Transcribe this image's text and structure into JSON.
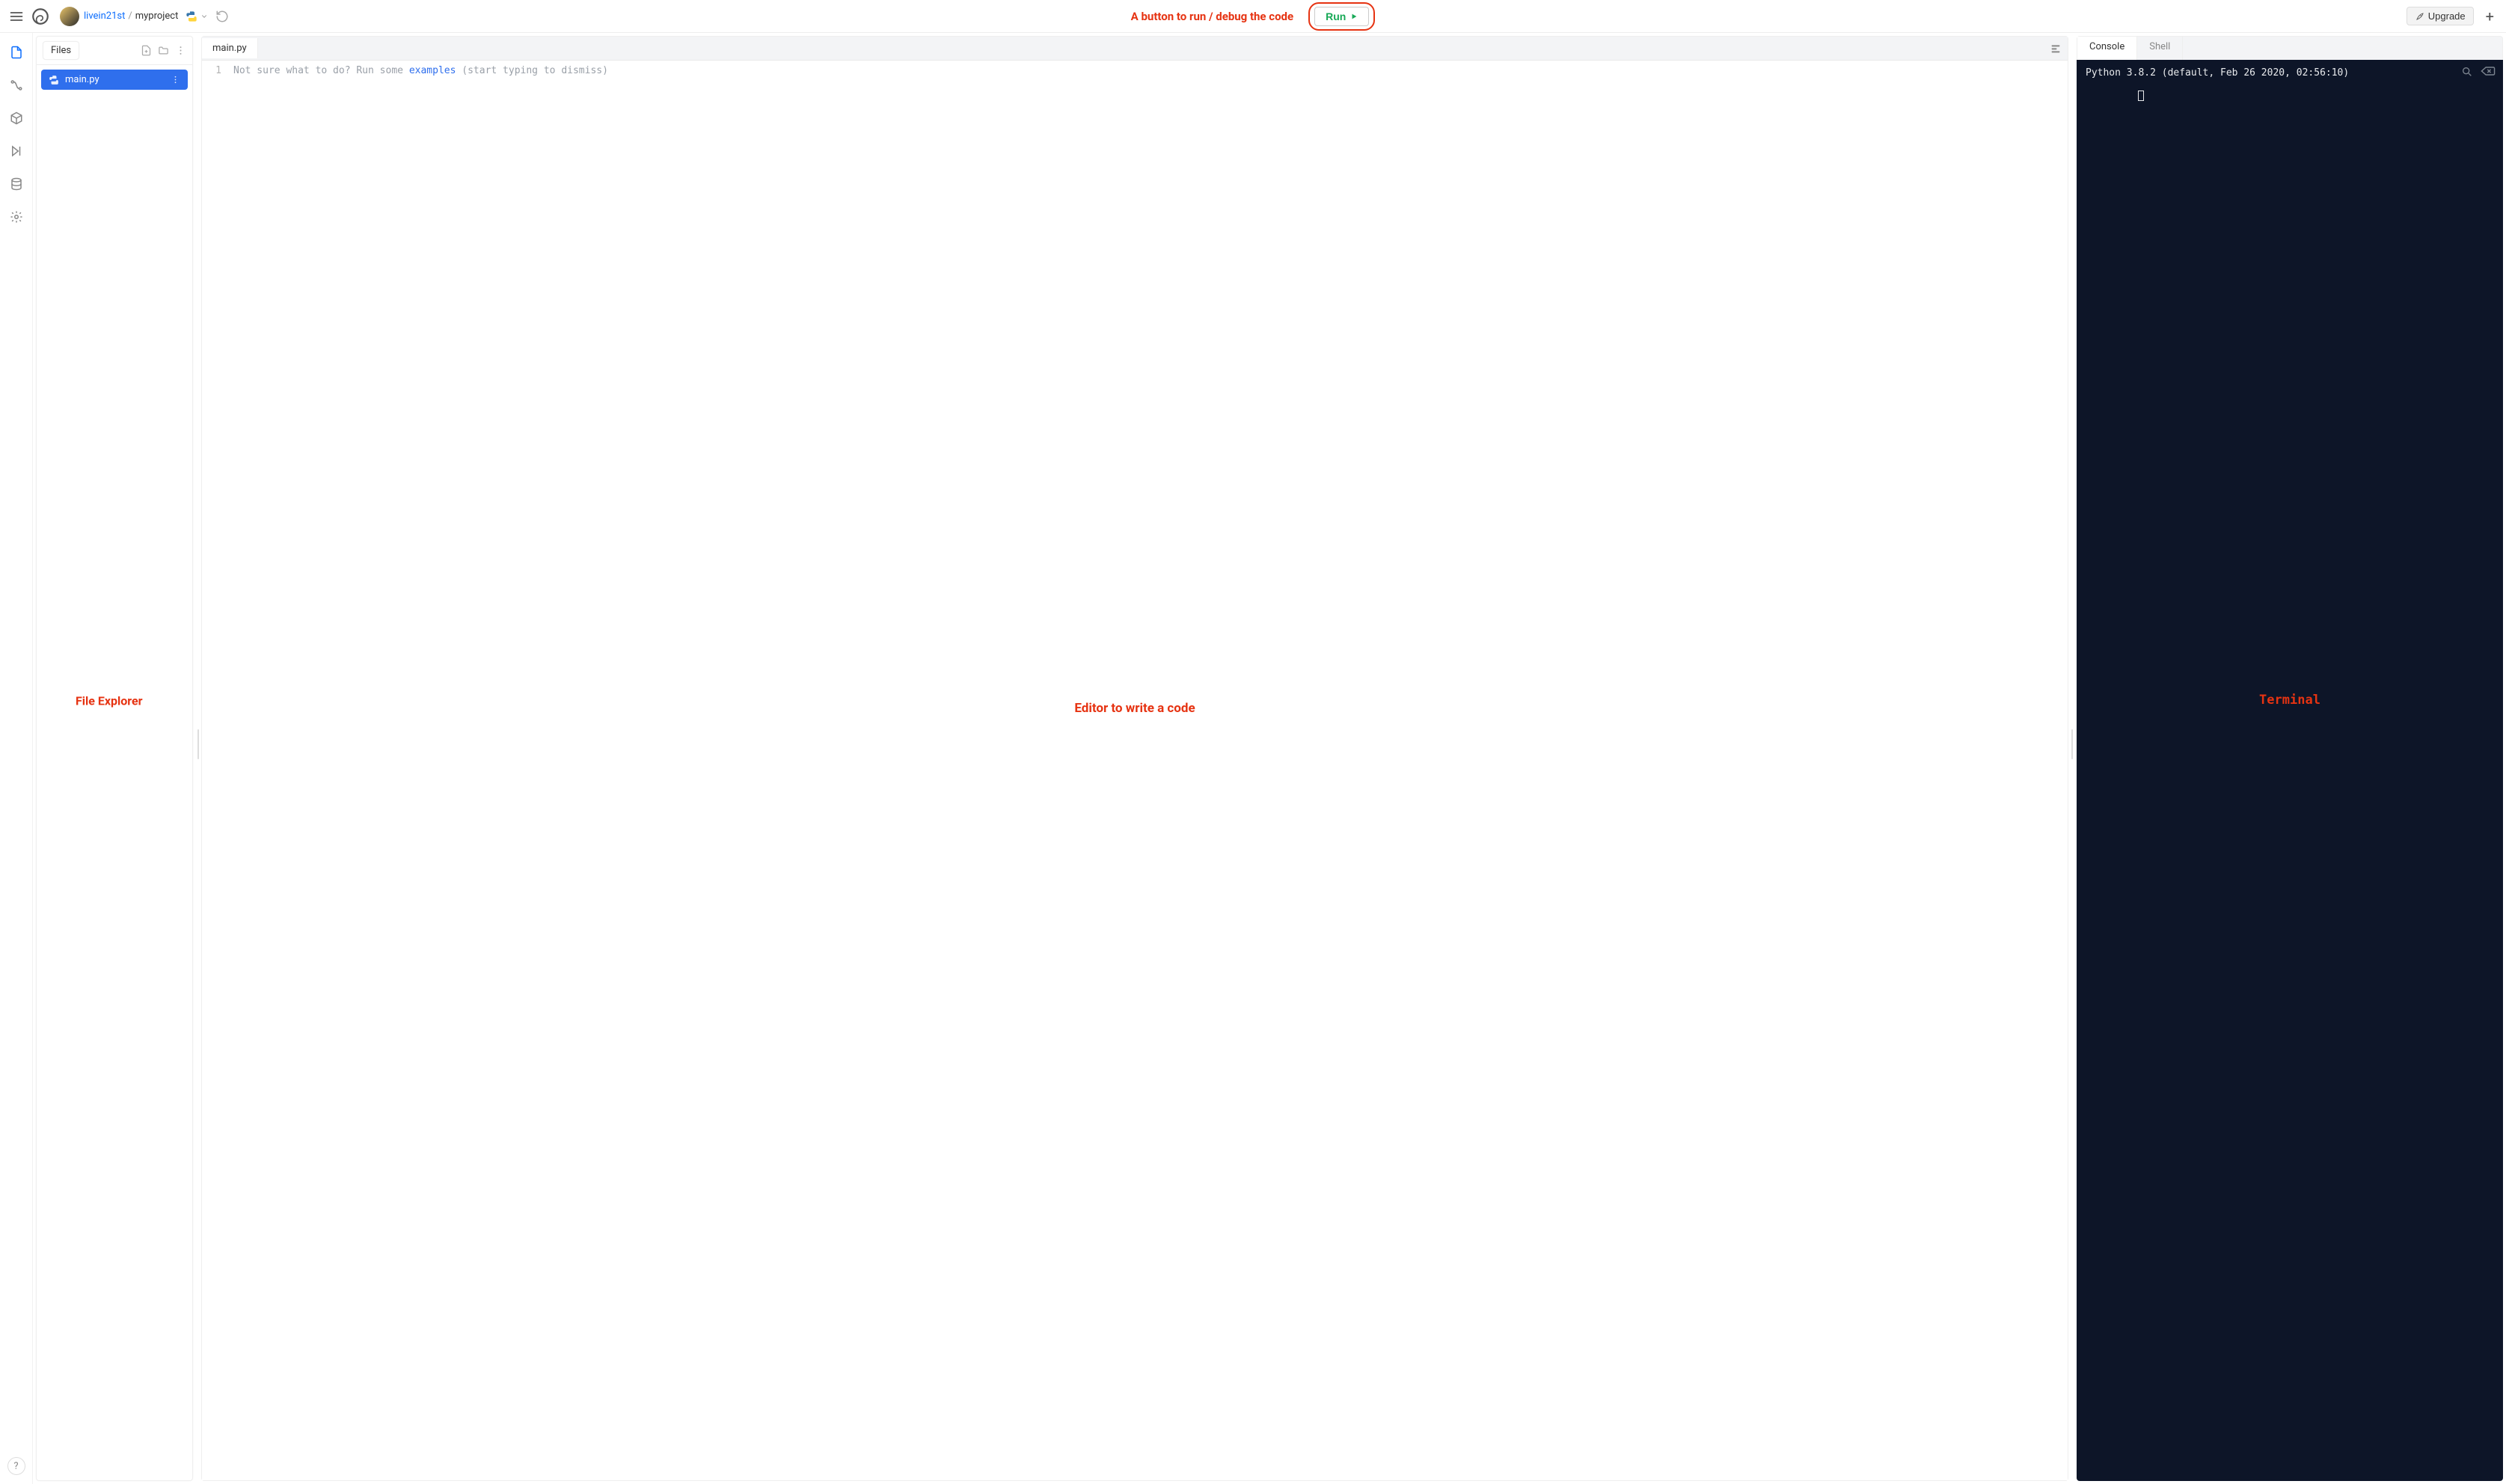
{
  "header": {
    "username": "livein21st",
    "project": "myproject",
    "run_label": "Run",
    "upgrade_label": "Upgrade"
  },
  "annotations": {
    "run_button": "A button to run / debug the code",
    "file_explorer": "File Explorer",
    "editor": "Editor to write a code",
    "terminal": "Terminal"
  },
  "filepanel": {
    "tab_label": "Files",
    "files": [
      {
        "name": "main.py"
      }
    ]
  },
  "editor": {
    "tab": "main.py",
    "line_number": "1",
    "placeholder_pre": "Not sure what to do? Run some ",
    "placeholder_link": "examples",
    "placeholder_post": " (start typing to dismiss)"
  },
  "console": {
    "tabs": {
      "console": "Console",
      "shell": "Shell"
    },
    "line1": "Python 3.8.2 (default, Feb 26 2020, 02:56:10)",
    "prompt": ""
  }
}
